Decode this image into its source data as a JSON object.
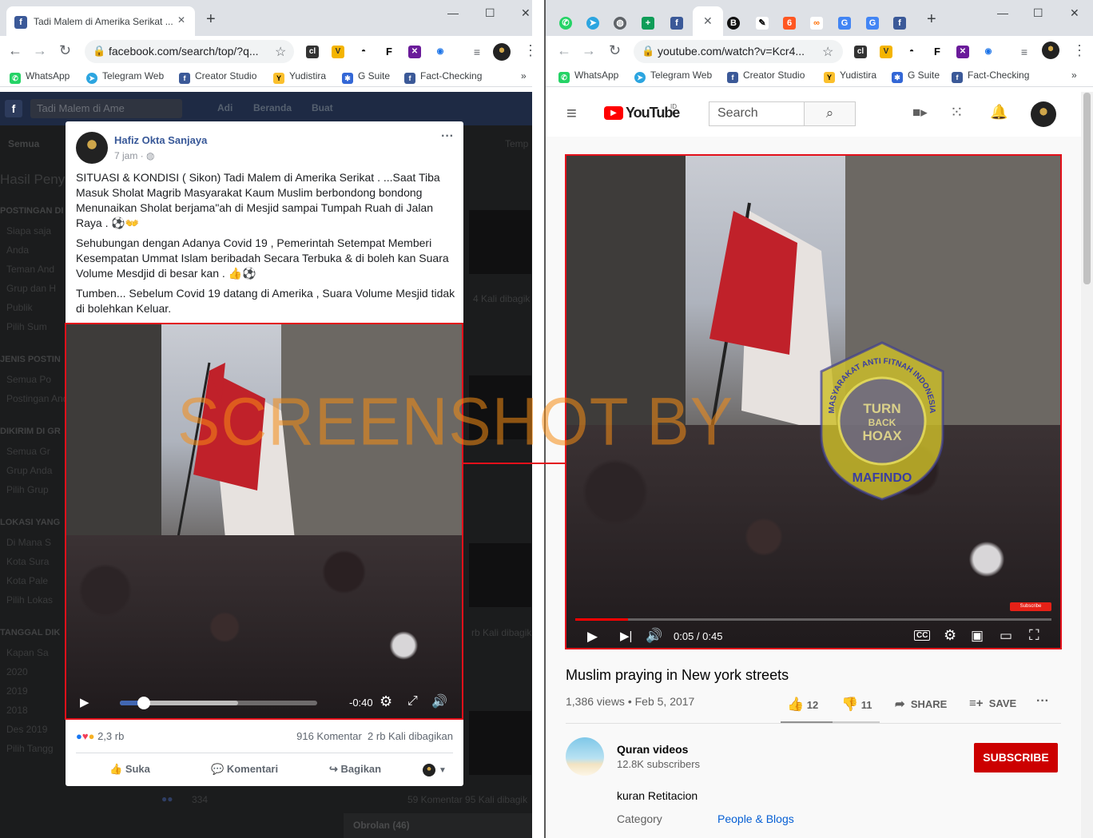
{
  "left_window": {
    "tab_title": "Tadi Malem di Amerika Serikat ...",
    "url": "facebook.com/search/top/?q...",
    "bookmarks": [
      "WhatsApp",
      "Telegram Web",
      "Creator Studio",
      "Yudistira",
      "G Suite",
      "Fact-Checking"
    ],
    "fb_search_value": "Tadi Malem di Ame",
    "fb_nav": [
      "Adi",
      "Beranda",
      "Buat"
    ],
    "dim_tab": "Semua",
    "dim_tab_right": "Temp",
    "dim_results_title": "Hasil Peny",
    "dim_sidebar": [
      {
        "head": "POSTINGAN DI",
        "items": [
          "Siapa saja",
          "Anda",
          "Teman And",
          "Grup dan H",
          "Publik",
          "Pilih Sum"
        ]
      },
      {
        "head": "JENIS POSTIN",
        "items": [
          "Semua Po",
          "Postingan Anda Lihat"
        ]
      },
      {
        "head": "DIKIRIM DI GR",
        "items": [
          "Semua Gr",
          "Grup Anda",
          "Pilih Grup"
        ]
      },
      {
        "head": "LOKASI YANG",
        "items": [
          "Di Mana S",
          "Kota Sura",
          "Kota Pale",
          "Pilih Lokas"
        ]
      },
      {
        "head": "TANGGAL DIK",
        "items": [
          "Kapan Sa",
          "2020",
          "2019",
          "2018",
          "Des 2019",
          "Pilih Tangg"
        ]
      }
    ],
    "dim_side_texts": [
      "4 Kali dibagik",
      "rb Kali dibagik"
    ],
    "dim_bottom": {
      "reactions": "334",
      "stats": "59 Komentar  95 Kali dibagik",
      "chat": "Obrolan (46)"
    },
    "post": {
      "author": "Hafiz Okta Sanjaya",
      "time": "7 jam ·",
      "paragraphs": [
        "SITUASI & KONDISI ( Sikon) Tadi Malem di Amerika Serikat . ...Saat Tiba Masuk Sholat Magrib Masyarakat Kaum Muslim berbondong bondong Menunaikan Sholat berjama\"ah di Mesjid sampai Tumpah Ruah di Jalan Raya . ⚽👐",
        "Sehubungan dengan Adanya Covid 19 , Pemerintah Setempat Memberi Kesempatan Ummat Islam beribadah Secara Terbuka & di boleh kan Suara Volume Mesdjid di besar kan . 👍⚽",
        "Tumben... Sebelum Covid 19 datang di Amerika , Suara Volume Mesjid tidak di bolehkan Keluar."
      ],
      "video_time_remaining": "-0:40",
      "video_progress": 0.12,
      "video_buffered": 0.6,
      "reactions_count": "2,3 rb",
      "comments": "916 Komentar",
      "shares": "2 rb Kali dibagikan",
      "actions": [
        "Suka",
        "Komentari",
        "Bagikan"
      ]
    }
  },
  "watermark": "SCREENSHOT BY",
  "right_window": {
    "url": "youtube.com/watch?v=Kcr4...",
    "bookmarks": [
      "WhatsApp",
      "Telegram Web",
      "Creator Studio",
      "Yudistira",
      "G Suite",
      "Fact-Checking"
    ],
    "yt_logo": "YouTube",
    "yt_logo_region": "ID",
    "search_placeholder": "Search",
    "video_time": "0:05 / 0:45",
    "video_progress": 0.11,
    "video_buffered": 0.11,
    "subscribe_overlay": "Subscribe",
    "badge": {
      "top": "MASYARAKAT ANTI FITNAH INDONESIA",
      "center_1": "TURN",
      "center_2": "BACK",
      "center_3": "HOAX",
      "bottom": "MAFINDO"
    },
    "title": "Muslim praying in New york streets",
    "views_date": "1,386 views • Feb 5, 2017",
    "likes": "12",
    "dislikes": "11",
    "share_label": "SHARE",
    "save_label": "SAVE",
    "channel": "Quran videos",
    "subscribers": "12.8K subscribers",
    "subscribe_label": "SUBSCRIBE",
    "description": "kuran Retitacion",
    "category_label": "Category",
    "category_value": "People & Blogs"
  }
}
